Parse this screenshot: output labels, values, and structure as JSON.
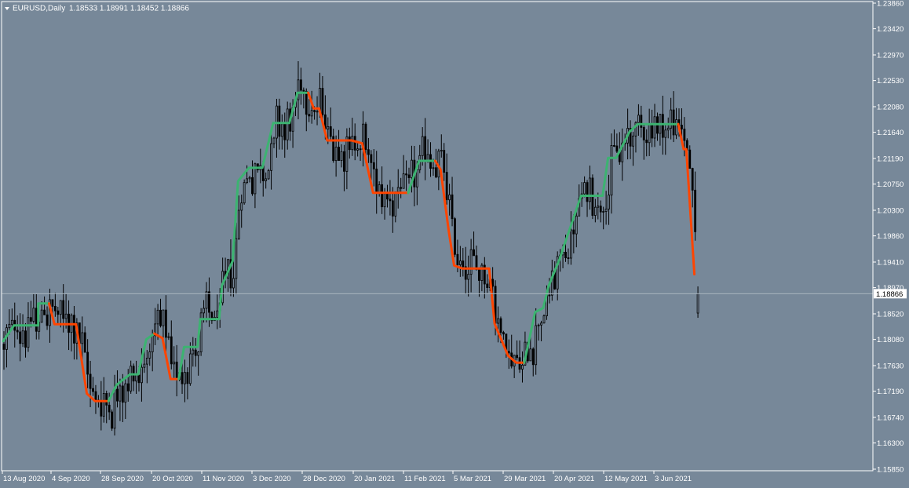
{
  "header": {
    "symbol_label": "EURUSD,Daily",
    "ohlc_label": "1.18533 1.18991 1.18452 1.18866",
    "dropdown_icon": "triangle-down-icon"
  },
  "colors": {
    "background": "#778899",
    "candle": "#000000",
    "axis": "#ffffff",
    "uptrend_line": "#3cb371",
    "downtrend_line": "#ff4500",
    "bid_line": "#a9b4be",
    "price_tag_bg": "#ffffff",
    "price_tag_text": "#000000"
  },
  "price_tag": {
    "label": "1.18866",
    "value": 1.18866
  },
  "chart_data": {
    "type": "candlestick",
    "title": "EURUSD,Daily",
    "symbol": "EURUSD",
    "timeframe": "Daily",
    "ylim": [
      1.1585,
      1.2386
    ],
    "y_ticks": [
      1.2386,
      1.2342,
      1.2297,
      1.2253,
      1.2208,
      1.2164,
      1.2119,
      1.2075,
      1.203,
      1.1986,
      1.1941,
      1.1897,
      1.1852,
      1.1808,
      1.1763,
      1.1719,
      1.1674,
      1.163,
      1.1585
    ],
    "y_tick_labels": [
      "1.23860",
      "1.23420",
      "1.22970",
      "1.22530",
      "1.22080",
      "1.21640",
      "1.21190",
      "1.20750",
      "1.20300",
      "1.19860",
      "1.19410",
      "1.18970",
      "1.18520",
      "1.18080",
      "1.17630",
      "1.17190",
      "1.16740",
      "1.16300",
      "1.15850"
    ],
    "x_tick_labels": [
      "13 Aug 2020",
      "4 Sep 2020",
      "28 Sep 2020",
      "20 Oct 2020",
      "11 Nov 2020",
      "3 Dec 2020",
      "28 Dec 2020",
      "20 Jan 2021",
      "11 Feb 2021",
      "5 Mar 2021",
      "29 Mar 2021",
      "20 Apr 2021",
      "12 May 2021",
      "3 Jun 2021"
    ],
    "grid": false,
    "last_ohlc": {
      "open": 1.18533,
      "high": 1.18991,
      "low": 1.18452,
      "close": 1.18866
    },
    "indicator": {
      "type": "trend-stop line",
      "series": [
        {
          "color": "up",
          "points": [
            [
              0,
              1.1805
            ],
            [
              4,
              1.1832
            ],
            [
              13,
              1.1832
            ],
            [
              13,
              1.187
            ],
            [
              17,
              1.187
            ]
          ]
        },
        {
          "color": "down",
          "points": [
            [
              17,
              1.187
            ],
            [
              19,
              1.1834
            ],
            [
              27,
              1.1834
            ],
            [
              31,
              1.1715
            ],
            [
              34,
              1.1702
            ],
            [
              39,
              1.1702
            ]
          ]
        },
        {
          "color": "up",
          "points": [
            [
              39,
              1.1702
            ],
            [
              42,
              1.173
            ],
            [
              47,
              1.1748
            ],
            [
              50,
              1.1748
            ],
            [
              53,
              1.1808
            ],
            [
              56,
              1.1818
            ],
            [
              56,
              1.1818
            ]
          ]
        },
        {
          "color": "down",
          "points": [
            [
              56,
              1.1818
            ],
            [
              59,
              1.181
            ],
            [
              62,
              1.174
            ],
            [
              65,
              1.174
            ]
          ]
        },
        {
          "color": "up",
          "points": [
            [
              65,
              1.174
            ],
            [
              67,
              1.1795
            ],
            [
              72,
              1.1795
            ],
            [
              73,
              1.1843
            ],
            [
              80,
              1.1843
            ],
            [
              81,
              1.19
            ],
            [
              85,
              1.1943
            ],
            [
              87,
              1.208
            ],
            [
              91,
              1.2103
            ],
            [
              96,
              1.2103
            ],
            [
              100,
              1.218
            ],
            [
              106,
              1.218
            ],
            [
              109,
              1.2232
            ],
            [
              113,
              1.2232
            ]
          ]
        },
        {
          "color": "down",
          "points": [
            [
              113,
              1.2232
            ],
            [
              115,
              1.2205
            ],
            [
              117,
              1.2205
            ],
            [
              120,
              1.215
            ],
            [
              124,
              1.215
            ],
            [
              129,
              1.215
            ],
            [
              133,
              1.2145
            ],
            [
              137,
              1.206
            ],
            [
              144,
              1.206
            ],
            [
              150,
              1.206
            ]
          ]
        },
        {
          "color": "up",
          "points": [
            [
              150,
              1.206
            ],
            [
              154,
              1.2115
            ],
            [
              160,
              1.2115
            ]
          ]
        },
        {
          "color": "down",
          "points": [
            [
              160,
              1.2115
            ],
            [
              162,
              1.21
            ],
            [
              165,
              1.1995
            ],
            [
              167,
              1.1935
            ],
            [
              170,
              1.193
            ],
            [
              180,
              1.193
            ],
            [
              182,
              1.1835
            ],
            [
              187,
              1.178
            ],
            [
              190,
              1.1768
            ],
            [
              193,
              1.1768
            ]
          ]
        },
        {
          "color": "up",
          "points": [
            [
              193,
              1.1768
            ],
            [
              197,
              1.1855
            ],
            [
              200,
              1.1862
            ],
            [
              202,
              1.19
            ],
            [
              206,
              1.1945
            ],
            [
              208,
              1.1973
            ],
            [
              210,
              1.2
            ],
            [
              214,
              1.2055
            ],
            [
              222,
              1.2055
            ],
            [
              224,
              1.212
            ],
            [
              227,
              1.212
            ],
            [
              232,
              1.2165
            ],
            [
              235,
              1.2178
            ],
            [
              240,
              1.2178
            ],
            [
              250,
              1.2178
            ]
          ]
        },
        {
          "color": "down",
          "points": [
            [
              250,
              1.2178
            ],
            [
              252,
              1.2135
            ],
            [
              253,
              1.2135
            ],
            [
              256,
              1.192
            ]
          ]
        }
      ]
    }
  }
}
